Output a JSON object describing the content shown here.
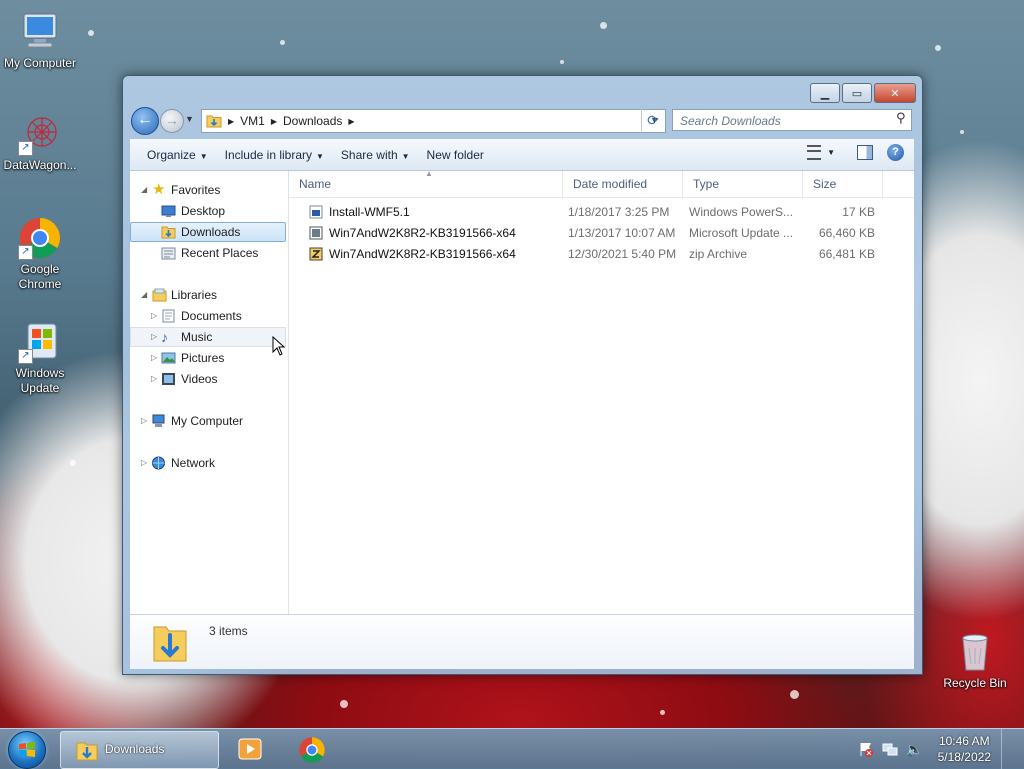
{
  "desktop": {
    "icons": [
      {
        "label": "My Computer"
      },
      {
        "label": "DataWagon..."
      },
      {
        "label": "Google\nChrome"
      },
      {
        "label": "Windows\nUpdate"
      },
      {
        "label": "Recycle Bin"
      }
    ]
  },
  "window": {
    "title_buttons": {
      "minimize": "▁",
      "maximize": "▭",
      "close": "✕"
    },
    "breadcrumbs": [
      "VM1",
      "Downloads"
    ],
    "search_placeholder": "Search Downloads",
    "toolbar": {
      "organize": "Organize",
      "include_in_library": "Include in library",
      "share_with": "Share with",
      "new_folder": "New folder"
    },
    "nav": {
      "favorites": "Favorites",
      "desktop": "Desktop",
      "downloads": "Downloads",
      "recent_places": "Recent Places",
      "libraries": "Libraries",
      "documents": "Documents",
      "music": "Music",
      "pictures": "Pictures",
      "videos": "Videos",
      "my_computer": "My Computer",
      "network": "Network"
    },
    "columns": {
      "name": "Name",
      "date_modified": "Date modified",
      "type": "Type",
      "size": "Size"
    },
    "files": [
      {
        "name": "Install-WMF5.1",
        "date": "1/18/2017 3:25 PM",
        "type": "Windows PowerS...",
        "size": "17 KB",
        "icon": "powershell-script-icon"
      },
      {
        "name": "Win7AndW2K8R2-KB3191566-x64",
        "date": "1/13/2017 10:07 AM",
        "type": "Microsoft Update ...",
        "size": "66,460 KB",
        "icon": "msu-package-icon"
      },
      {
        "name": "Win7AndW2K8R2-KB3191566-x64",
        "date": "12/30/2021 5:40 PM",
        "type": "zip Archive",
        "size": "66,481 KB",
        "icon": "zip-archive-icon"
      }
    ],
    "status": {
      "item_count": "3 items"
    }
  },
  "taskbar": {
    "active_window_label": "Downloads",
    "clock": {
      "time": "10:46 AM",
      "date": "5/18/2022"
    }
  },
  "colors": {
    "selection_bg": "#cce4f8",
    "selection_border": "#84acdd",
    "link_blue": "#1a2a44"
  }
}
